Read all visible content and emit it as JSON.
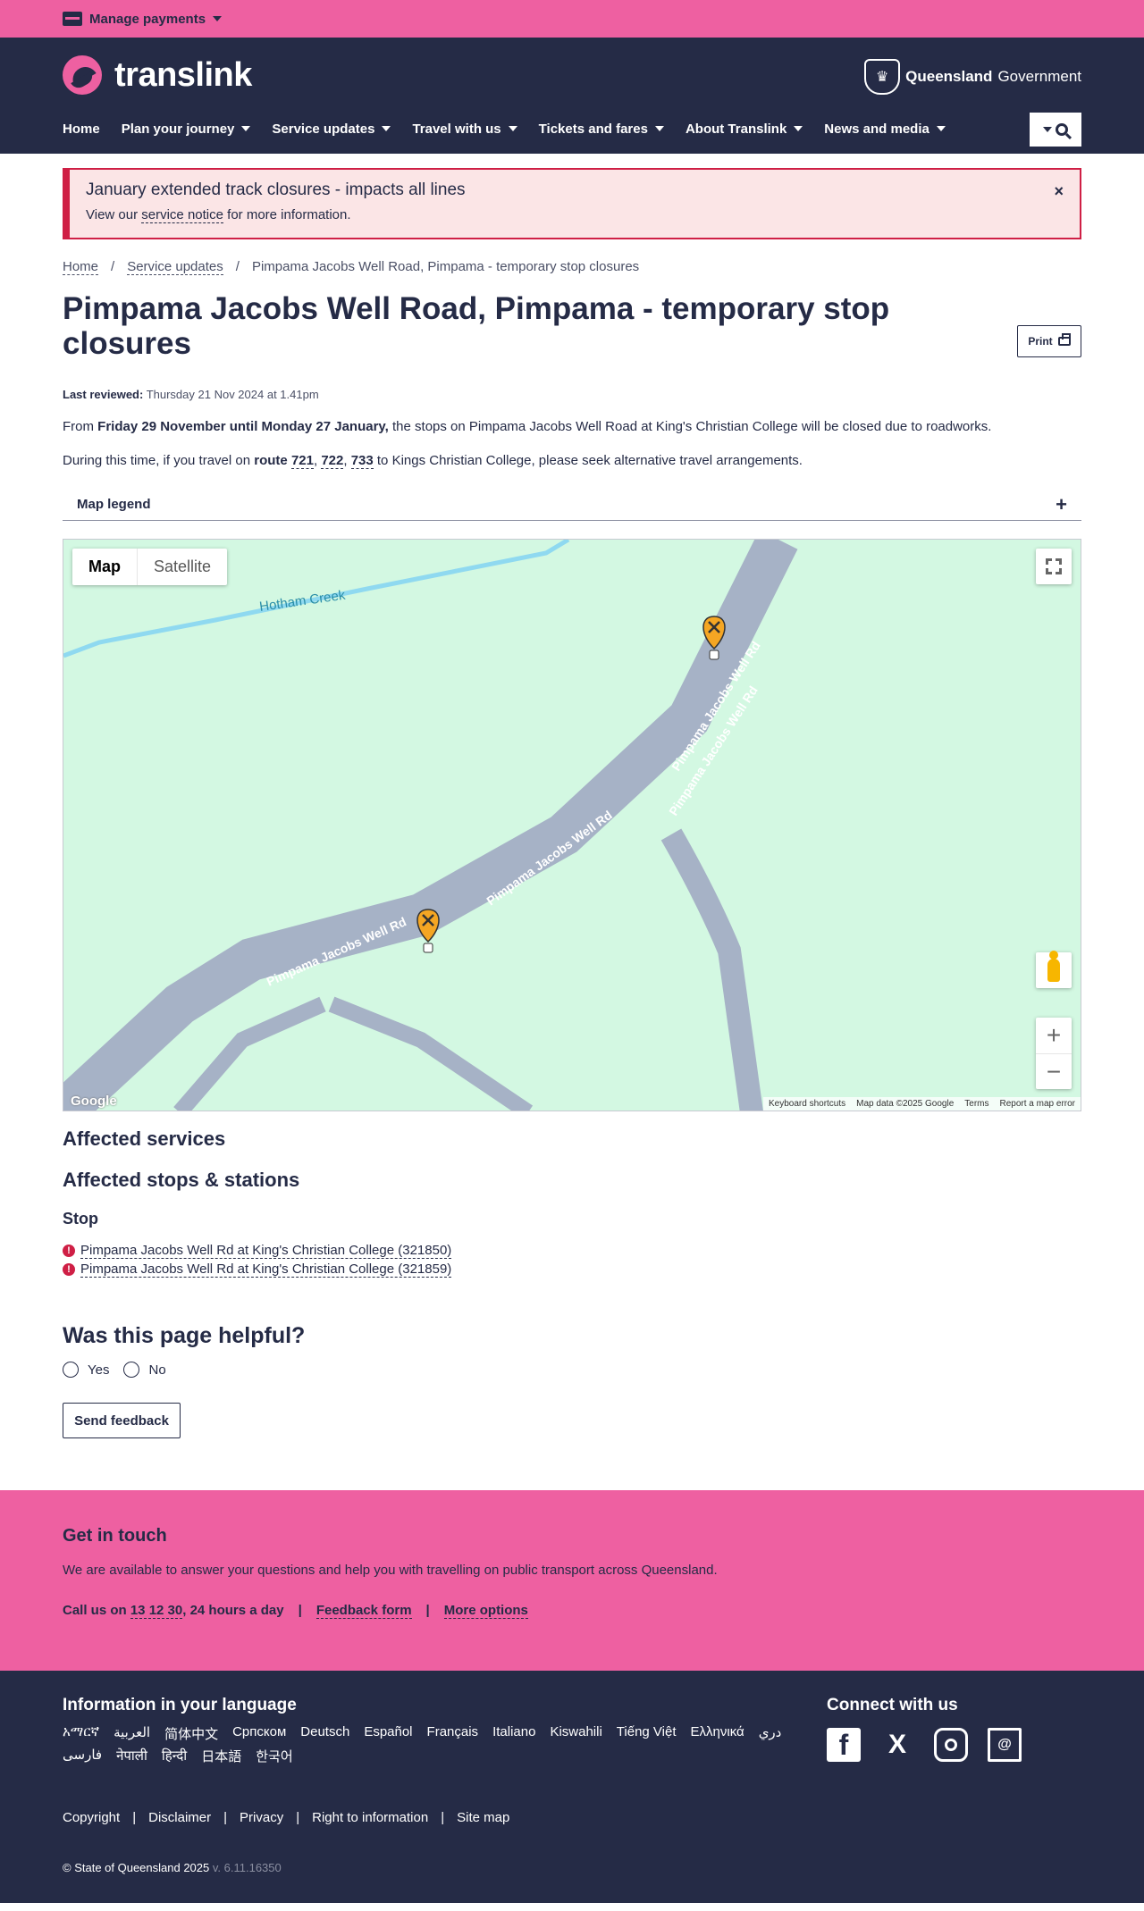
{
  "topbar": {
    "manage_payments": "Manage payments"
  },
  "header": {
    "logo_text": "translink",
    "gov_bold": "Queensland",
    "gov_rest": "Government",
    "nav": [
      "Home",
      "Plan your journey",
      "Service updates",
      "Travel with us",
      "Tickets and fares",
      "About Translink",
      "News and media"
    ]
  },
  "alert": {
    "title": "January extended track closures - impacts all lines",
    "text_before": "View our ",
    "link": "service notice",
    "text_after": " for more information.",
    "close": "×"
  },
  "breadcrumb": {
    "home": "Home",
    "sep": "/",
    "service_updates": "Service updates",
    "current": "Pimpama Jacobs Well Road, Pimpama - temporary stop closures"
  },
  "page": {
    "title": "Pimpama Jacobs Well Road, Pimpama - temporary stop closures",
    "print": "Print",
    "reviewed_label": "Last reviewed:",
    "reviewed_date": " Thursday 21 Nov 2024 at 1.41pm",
    "p1_from": "From ",
    "p1_dates": "Friday 29 November until Monday 27 January,",
    "p1_rest": " the stops on Pimpama Jacobs Well Road at King's Christian College will be closed due to roadworks.",
    "p2_before": "During this time, if you travel on ",
    "p2_route": "route",
    "routes": [
      "721",
      "722",
      "733"
    ],
    "p2_after": " to Kings Christian College, please seek alternative travel arrangements.",
    "legend": "Map legend",
    "legend_plus": "+"
  },
  "map": {
    "type_map": "Map",
    "type_satellite": "Satellite",
    "creek_label": "Hotham Creek",
    "road_label": "Pimpama Jacobs Well Rd",
    "zoom_in": "+",
    "zoom_out": "−",
    "google": "Google",
    "footer": [
      "Keyboard shortcuts",
      "Map data ©2025 Google",
      "Terms",
      "Report a map error"
    ]
  },
  "affected": {
    "services_heading": "Affected services",
    "stops_heading": "Affected stops & stations",
    "stop_heading": "Stop",
    "stops": [
      "Pimpama Jacobs Well Rd at King's Christian College (321850)",
      "Pimpama Jacobs Well Rd at King's Christian College (321859)"
    ]
  },
  "feedback": {
    "question": "Was this page helpful?",
    "yes": "Yes",
    "no": "No",
    "send": "Send feedback"
  },
  "contact": {
    "title": "Get in touch",
    "desc": "We are available to answer your questions and help you with travelling on public transport across Queensland.",
    "call_prefix": "Call us on ",
    "phone": "13 12 30",
    "call_suffix": ", 24 hours a day",
    "sep": "|",
    "feedback_form": "Feedback form",
    "more_options": "More options"
  },
  "footer": {
    "lang_title": "Information in your language",
    "languages": [
      "አማርኛ",
      "العربية",
      "简体中文",
      "Српском",
      "Deutsch",
      "Español",
      "Français",
      "Italiano",
      "Kiswahili",
      "Tiếng Việt",
      "Ελληνικά",
      "دري",
      "فارسی",
      "नेपाली",
      "हिन्दी",
      "日本語",
      "한국어"
    ],
    "connect_title": "Connect with us",
    "legal": [
      "Copyright",
      "Disclaimer",
      "Privacy",
      "Right to information",
      "Site map"
    ],
    "legal_sep": "|",
    "copyright": "© State of Queensland 2025",
    "version": " v. 6.11.16350"
  }
}
